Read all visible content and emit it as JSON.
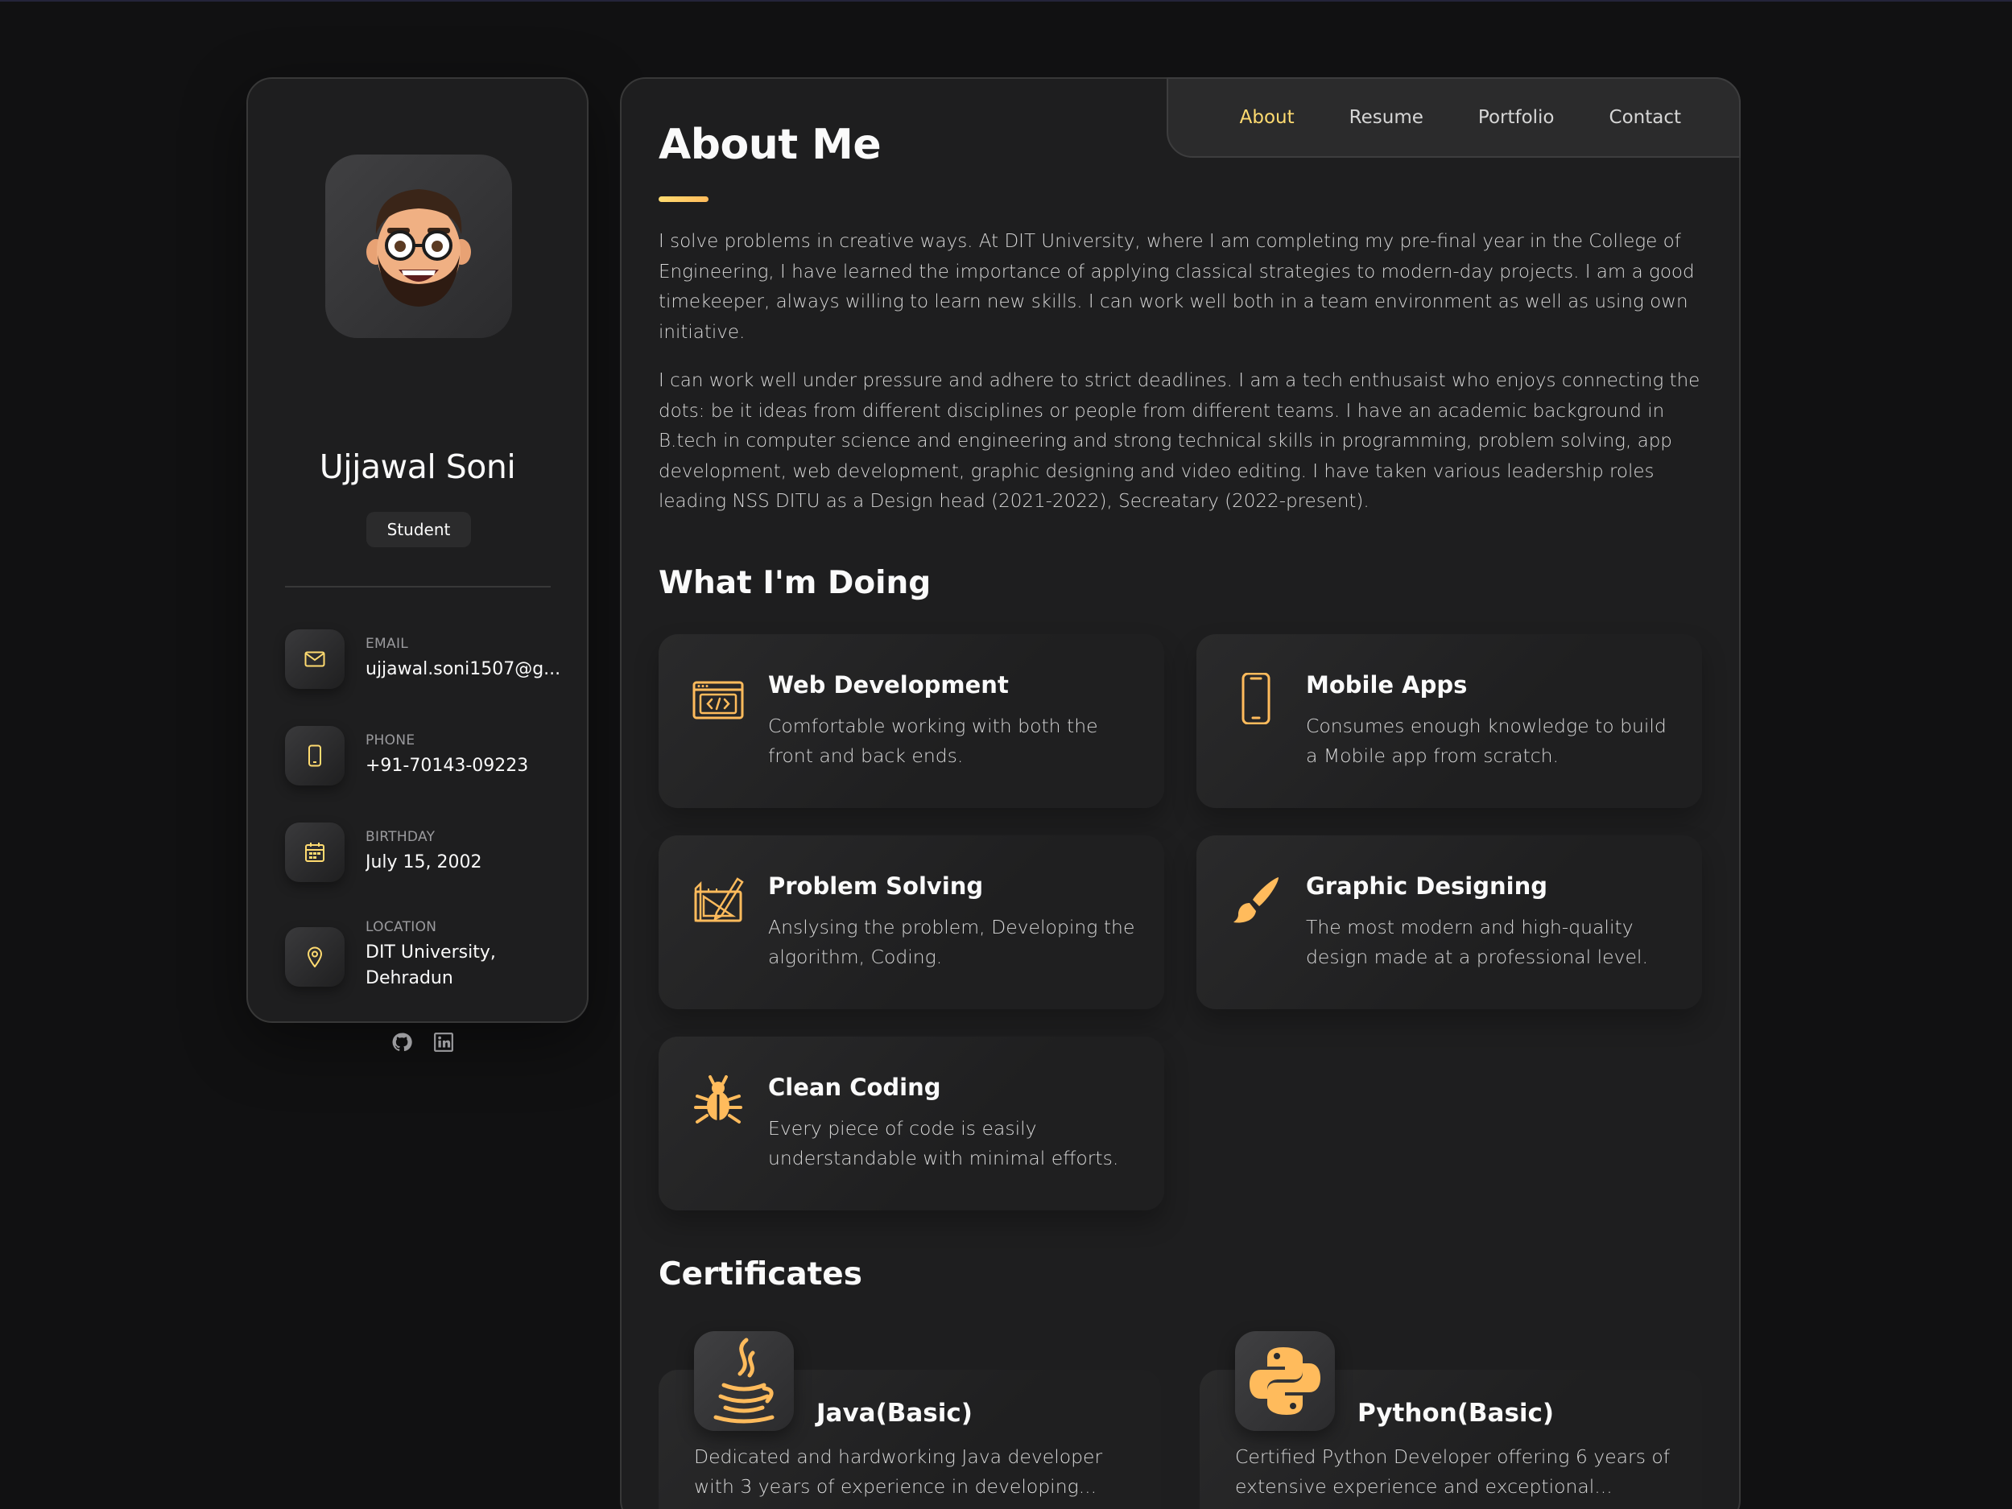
{
  "colors": {
    "accent": "#ffdb70",
    "background": "#111112",
    "panel": "#1e1e1f"
  },
  "sidebar": {
    "name": "Ujjawal Soni",
    "title": "Student",
    "contacts": [
      {
        "icon": "mail-icon",
        "label": "Email",
        "value": "ujjawal.soni1507@g..."
      },
      {
        "icon": "phone-icon",
        "label": "Phone",
        "value": "+91-70143-09223"
      },
      {
        "icon": "calendar-icon",
        "label": "Birthday",
        "value": "July 15, 2002"
      },
      {
        "icon": "location-pin-icon",
        "label": "Location",
        "value": "DIT University, Dehradun"
      }
    ],
    "social": [
      "github-icon",
      "linkedin-icon"
    ]
  },
  "nav": {
    "items": [
      {
        "label": "About",
        "active": true
      },
      {
        "label": "Resume",
        "active": false
      },
      {
        "label": "Portfolio",
        "active": false
      },
      {
        "label": "Contact",
        "active": false
      }
    ]
  },
  "about": {
    "title": "About Me",
    "paragraphs": [
      "I solve problems in creative ways. At DIT University, where I am completing my pre-final year in the College of Engineering, I have learned the importance of applying classical strategies to modern-day projects. I am a good timekeeper, always willing to learn new skills. I can work well both in a team environment as well as using own initiative.",
      "I can work well under pressure and adhere to strict deadlines. I am a tech enthusaist who enjoys connecting the dots: be it ideas from different disciplines or people from different teams. I have an academic background in B.tech in computer science and engineering and strong technical skills in programming, problem solving, app development, web development, graphic designing and video editing. I have taken various leadership roles leading NSS DITU as a Design head (2021-2022), Secreatary (2022-present)."
    ]
  },
  "services": {
    "title": "What I'm Doing",
    "items": [
      {
        "icon": "web-code-icon",
        "title": "Web Development",
        "text": "Comfortable working with both the front and back ends."
      },
      {
        "icon": "mobile-phone-icon",
        "title": "Mobile Apps",
        "text": "Consumes enough knowledge to build a Mobile app from scratch."
      },
      {
        "icon": "design-tools-icon",
        "title": "Problem Solving",
        "text": "Anslysing the problem, Developing the algorithm, Coding."
      },
      {
        "icon": "paintbrush-icon",
        "title": "Graphic Designing",
        "text": "The most modern and high-quality design made at a professional level."
      },
      {
        "icon": "bug-icon",
        "title": "Clean Coding",
        "text": "Every piece of code is easily understandable with minimal efforts."
      }
    ]
  },
  "certificates": {
    "title": "Certificates",
    "items": [
      {
        "icon": "java-icon",
        "title": "Java(Basic)",
        "text": "Dedicated and hardworking Java developer with 3 years of experience in developing..."
      },
      {
        "icon": "python-icon",
        "title": "Python(Basic)",
        "text": "Certified Python Developer offering 6 years of extensive experience and exceptional..."
      }
    ]
  }
}
